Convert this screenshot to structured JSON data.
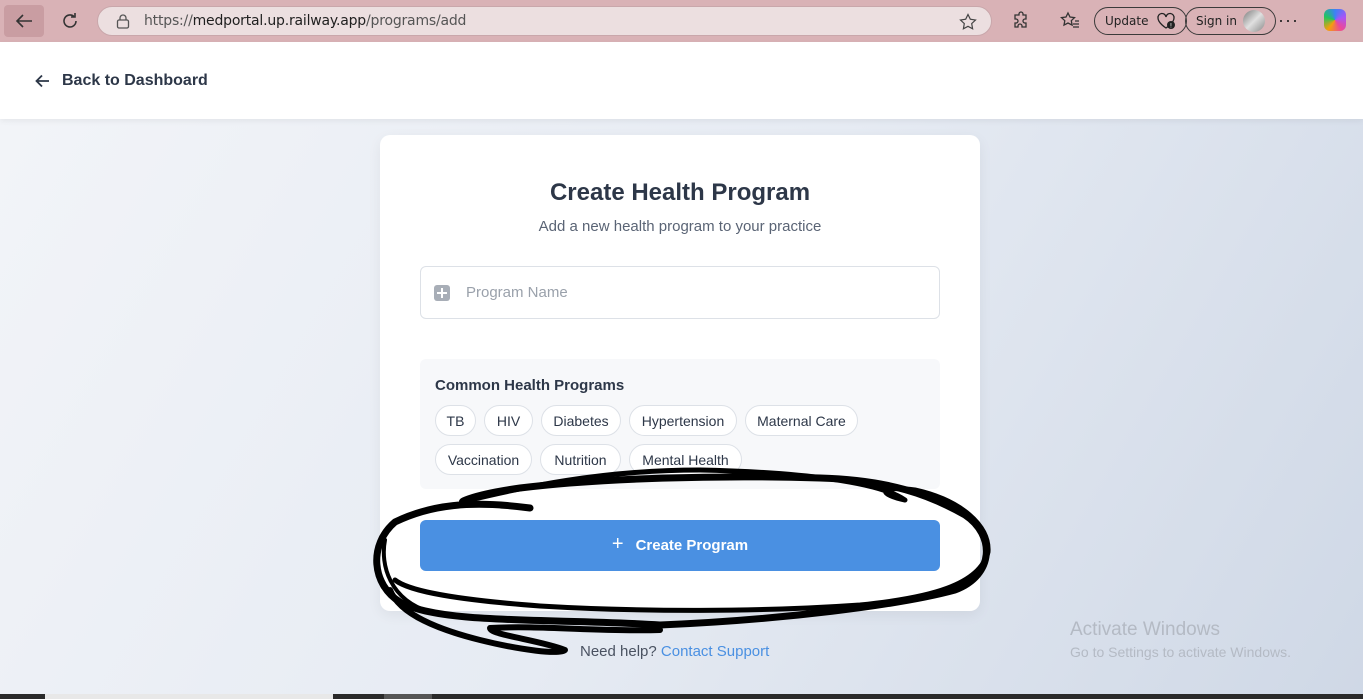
{
  "browser": {
    "url_prefix": "https://",
    "url_host": "medportal.up.railway.app",
    "url_path": "/programs/add",
    "update_label": "Update",
    "signin_label": "Sign in",
    "more_label": "···",
    "icons": [
      "back-arrow-icon",
      "refresh-icon",
      "lock-icon",
      "star-icon",
      "extensions-icon",
      "favorites-icon",
      "heart-pulse-icon",
      "avatar-icon",
      "copilot-icon"
    ]
  },
  "header": {
    "back_label": "Back to Dashboard"
  },
  "form": {
    "title": "Create Health Program",
    "subtitle": "Add a new health program to your practice",
    "program_name_placeholder": "Program Name",
    "program_name_value": "",
    "common_title": "Common Health Programs",
    "chips": [
      "TB",
      "HIV",
      "Diabetes",
      "Hypertension",
      "Maternal Care",
      "Vaccination",
      "Nutrition",
      "Mental Health"
    ],
    "submit_icon": "+",
    "submit_label": "Create Program"
  },
  "footer": {
    "help_text": "Need help?",
    "support_link": "Contact Support"
  },
  "watermark": {
    "line1": "Activate Windows",
    "line2": "Go to Settings to activate Windows."
  },
  "colors": {
    "accent": "#4a90e2",
    "browser_bar": "#d9b2b6",
    "text": "#2d3748"
  }
}
